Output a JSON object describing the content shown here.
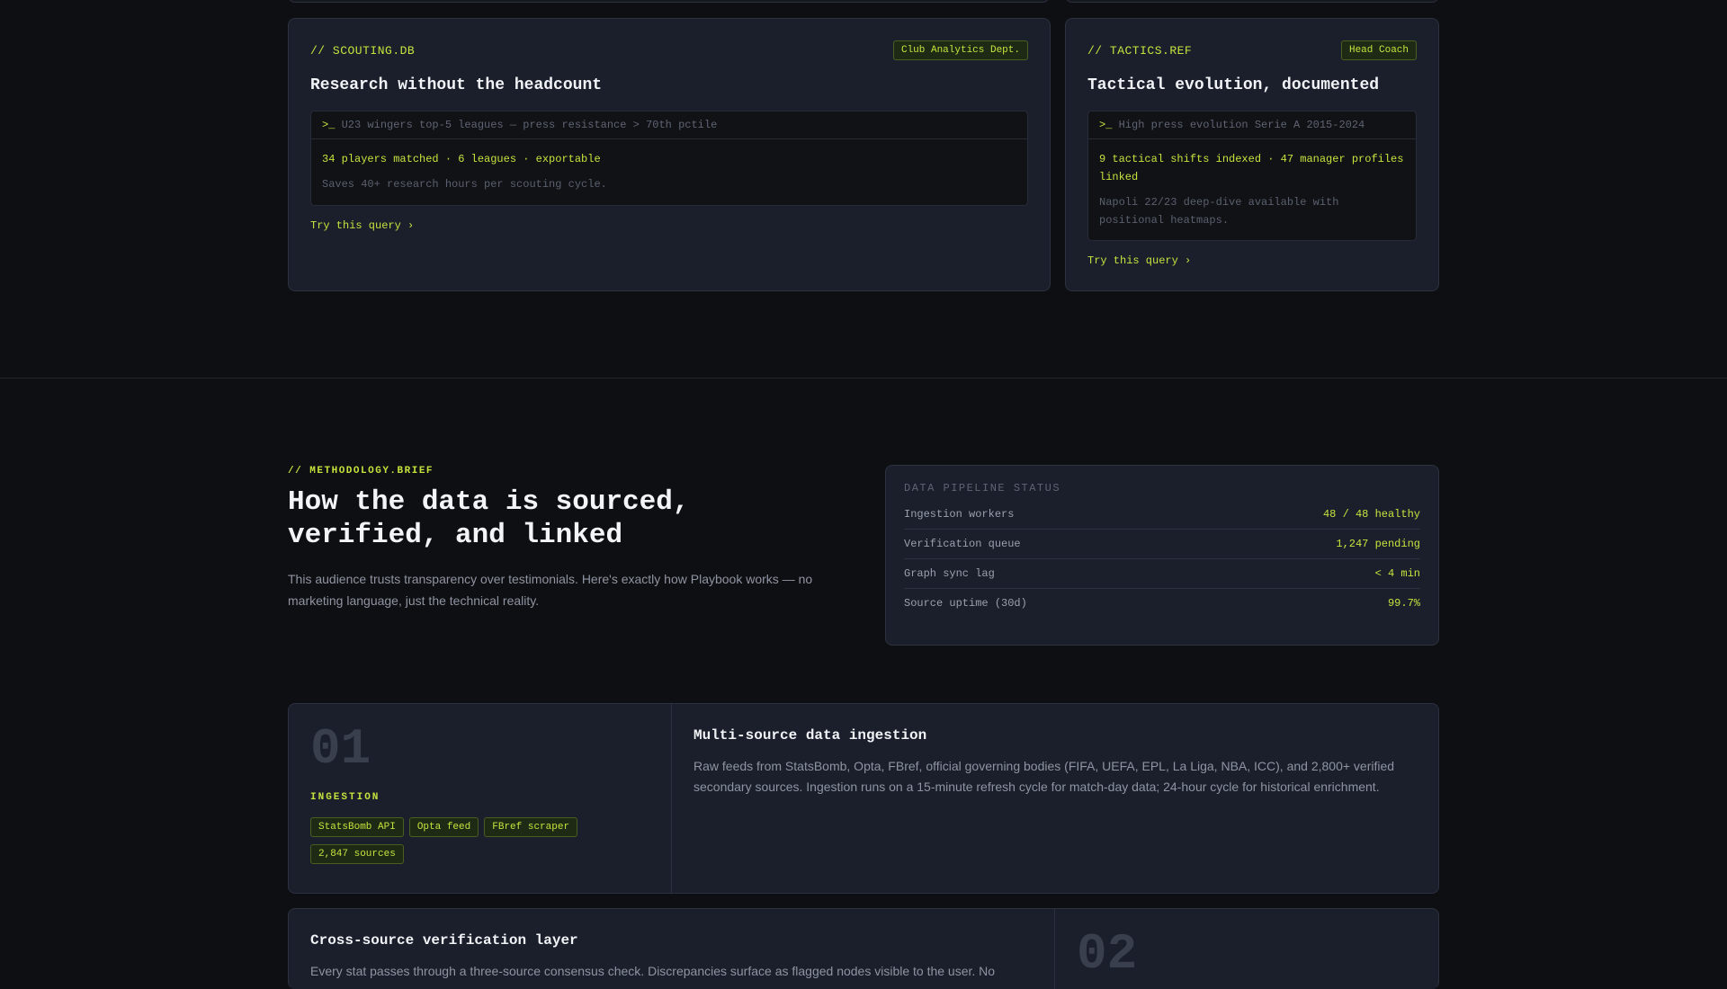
{
  "cards": [
    {
      "label": "// SCOUTING.DB",
      "badge": "Club Analytics Dept.",
      "title": "Research without the headcount",
      "prompt": ">_",
      "query": "U23 wingers top-5 leagues — press resistance > 70th pctile",
      "result": "34 players matched · 6 leagues · exportable",
      "note": "Saves 40+ research hours per scouting cycle.",
      "cta": "Try this query ›"
    },
    {
      "label": "// TACTICS.REF",
      "badge": "Head Coach",
      "title": "Tactical evolution, documented",
      "prompt": ">_",
      "query": "High press evolution Serie A 2015-2024",
      "result": "9 tactical shifts indexed · 47 manager profiles linked",
      "note": "Napoli 22/23 deep-dive available with positional heatmaps.",
      "cta": "Try this query ›"
    }
  ],
  "methodology": {
    "label": "// METHODOLOGY.BRIEF",
    "heading_line1": "How the data is sourced,",
    "heading_line2": "verified, and linked",
    "description": "This audience trusts transparency over testimonials. Here's exactly how Playbook works — no marketing language, just the technical reality."
  },
  "pipeline": {
    "title": "DATA PIPELINE STATUS",
    "rows": [
      {
        "key": "Ingestion workers",
        "value": "48 / 48 healthy"
      },
      {
        "key": "Verification queue",
        "value": "1,247 pending"
      },
      {
        "key": "Graph sync lag",
        "value": "< 4 min"
      },
      {
        "key": "Source uptime (30d)",
        "value": "99.7%"
      }
    ]
  },
  "steps": [
    {
      "number": "01",
      "label": "INGESTION",
      "tags": [
        "StatsBomb API",
        "Opta feed",
        "FBref scraper",
        "2,847 sources"
      ],
      "title": "Multi-source data ingestion",
      "description": "Raw feeds from StatsBomb, Opta, FBref, official governing bodies (FIFA, UEFA, EPL, La Liga, NBA, ICC), and 2,800+ verified secondary sources. Ingestion runs on a 15-minute refresh cycle for match-day data; 24-hour cycle for historical enrichment."
    },
    {
      "number": "02",
      "title": "Cross-source verification layer",
      "description": "Every stat passes through a three-source consensus check. Discrepancies surface as flagged nodes visible to the user. No"
    }
  ],
  "colors": {
    "accent": "#c6e33d",
    "background": "#0e0f12",
    "card": "#1b1f2b"
  }
}
